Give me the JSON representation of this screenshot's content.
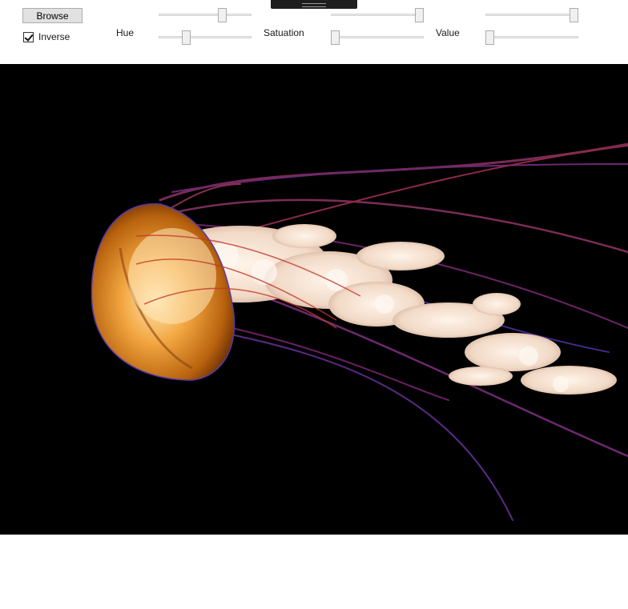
{
  "toolbar": {
    "browse_label": "Browse",
    "inverse_label": "Inverse",
    "inverse_checked": true
  },
  "labels": {
    "hue": "Hue",
    "saturation": "Satuation",
    "value": "Value"
  },
  "sliders": {
    "hue_max": 0.7,
    "hue_min": 0.27,
    "saturation_max": 0.99,
    "saturation_min": 0.0,
    "value_max": 0.99,
    "value_min": 0.0
  },
  "image": {
    "subject": "jellyfish on black background",
    "background": "#000000"
  }
}
